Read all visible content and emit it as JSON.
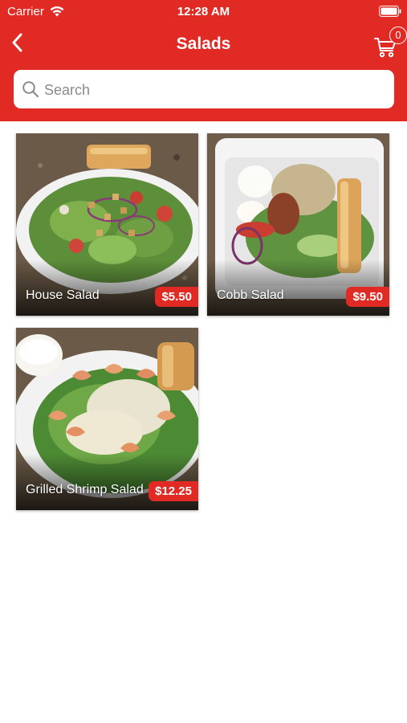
{
  "status_bar": {
    "carrier": "Carrier",
    "time": "12:28 AM",
    "icons": [
      "wifi-icon",
      "battery-icon"
    ]
  },
  "nav": {
    "title": "Salads",
    "back_icon": "chevron-left-icon",
    "cart_icon": "cart-icon",
    "cart_count": "0"
  },
  "search": {
    "placeholder": "Search",
    "value": "",
    "icon": "search-icon"
  },
  "colors": {
    "brand": "#e12a24",
    "badge": "#e12a24",
    "text_on_brand": "#ffffff"
  },
  "items": [
    {
      "name": "House Salad",
      "price": "$5.50"
    },
    {
      "name": "Cobb Salad",
      "price": "$9.50"
    },
    {
      "name": "Grilled Shrimp Salad",
      "price": "$12.25"
    }
  ]
}
